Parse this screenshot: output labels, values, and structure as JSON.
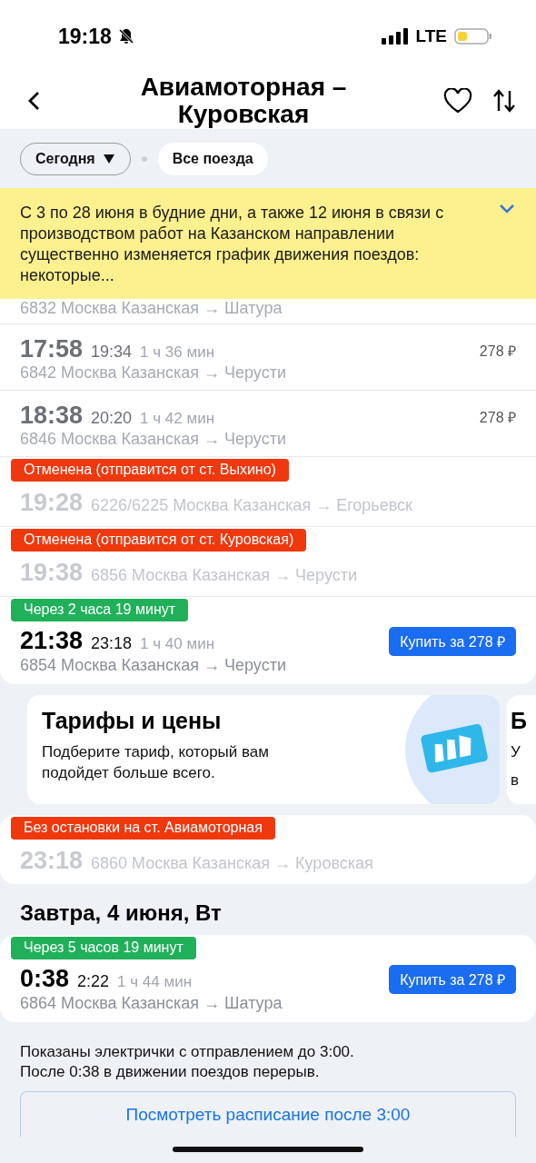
{
  "status_bar": {
    "time": "19:18",
    "network": "LTE"
  },
  "header": {
    "title": "Авиамоторная –\nКуровская"
  },
  "filters": [
    {
      "label": "Сегодня",
      "kind": "dropdown"
    },
    {
      "label": "Все поезда",
      "kind": "chip"
    }
  ],
  "notice": {
    "text": "С 3 по 28 июня в будние дни, а также 12 июня в связи с производством работ на Казанском направлении существенно изменяется график движения поездов: некоторые...",
    "expanded": false
  },
  "today": [
    {
      "kind": "partial",
      "route": "6832 Москва Казанская → Шатура"
    },
    {
      "kind": "past",
      "departure": "17:58",
      "arrival": "19:34",
      "duration": "1 ч 36 мин",
      "route": "6842 Москва Казанская → Черусти",
      "price": "278 ₽"
    },
    {
      "kind": "past",
      "departure": "18:38",
      "arrival": "20:20",
      "duration": "1 ч 42 мин",
      "route": "6846 Москва Казанская → Черусти",
      "price": "278 ₽"
    },
    {
      "kind": "cancelled",
      "badge": "Отменена (отправится от ст. Выхино)",
      "departure": "19:28",
      "route": "6226/6225 Москва Казанская → Егорьевск"
    },
    {
      "kind": "cancelled",
      "badge": "Отменена (отправится от ст. Куровская)",
      "departure": "19:38",
      "route": "6856 Москва Казанская → Черусти"
    },
    {
      "kind": "upcoming",
      "badge": "Через 2 часа 19 минут",
      "departure": "21:38",
      "arrival": "23:18",
      "duration": "1 ч 40 мин",
      "route": "6854 Москва Казанская → Черусти",
      "buy": "Купить за 278 ₽"
    }
  ],
  "promos": [
    {
      "title": "Тарифы и цены",
      "text": "Подберите тариф, который вам подойдет больше всего.",
      "kind": "ticket"
    },
    {
      "title": "Б",
      "lines": [
        "У",
        "в"
      ],
      "kind": "peek"
    }
  ],
  "late": [
    {
      "kind": "cancelled",
      "badge": "Без остановки на ст. Авиамоторная",
      "departure": "23:18",
      "route": "6860 Москва Казанская → Куровская"
    }
  ],
  "tomorrow": {
    "heading": "Завтра, 4 июня, Вт",
    "trains": [
      {
        "kind": "upcoming",
        "badge": "Через 5 часов 19 минут",
        "departure": "0:38",
        "arrival": "2:22",
        "duration": "1 ч 44 мин",
        "route": "6864 Москва Казанская → Шатура",
        "buy": "Купить за 278 ₽"
      }
    ]
  },
  "footer": {
    "notes": [
      "Показаны электрички с отправлением до 3:00.",
      "После 0:38 в движении поездов перерыв."
    ],
    "button": "Посмотреть расписание после 3:00"
  }
}
